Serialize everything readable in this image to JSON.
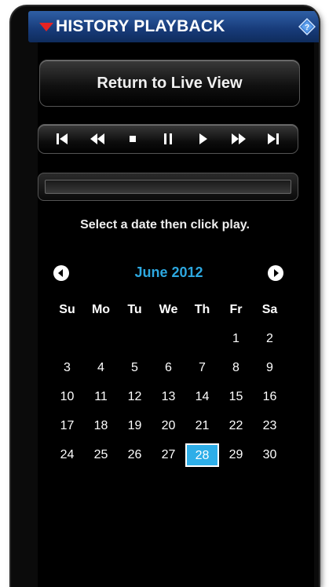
{
  "header": {
    "title": "HISTORY PLAYBACK",
    "collapse_icon": "triangle-down-icon",
    "help_icon": "diamond-help-icon"
  },
  "controls": {
    "return_label": "Return to Live View",
    "transport": [
      "skip-to-start-icon",
      "rewind-icon",
      "stop-icon",
      "pause-icon",
      "play-icon",
      "fast-forward-icon",
      "skip-to-end-icon"
    ]
  },
  "hint": "Select a date then click play.",
  "calendar": {
    "month_label": "June 2012",
    "weekdays": [
      "Su",
      "Mo",
      "Tu",
      "We",
      "Th",
      "Fr",
      "Sa"
    ],
    "weeks": [
      [
        "",
        "",
        "",
        "",
        "",
        "1",
        "2"
      ],
      [
        "3",
        "4",
        "5",
        "6",
        "7",
        "8",
        "9"
      ],
      [
        "10",
        "11",
        "12",
        "13",
        "14",
        "15",
        "16"
      ],
      [
        "17",
        "18",
        "19",
        "20",
        "21",
        "22",
        "23"
      ],
      [
        "24",
        "25",
        "26",
        "27",
        "28",
        "29",
        "30"
      ]
    ],
    "selected_day": "28"
  },
  "colors": {
    "accent": "#2da8e0",
    "title_bg": "#173a78",
    "collapse_arrow": "#e62323",
    "selected_bg": "#2eaee8"
  }
}
